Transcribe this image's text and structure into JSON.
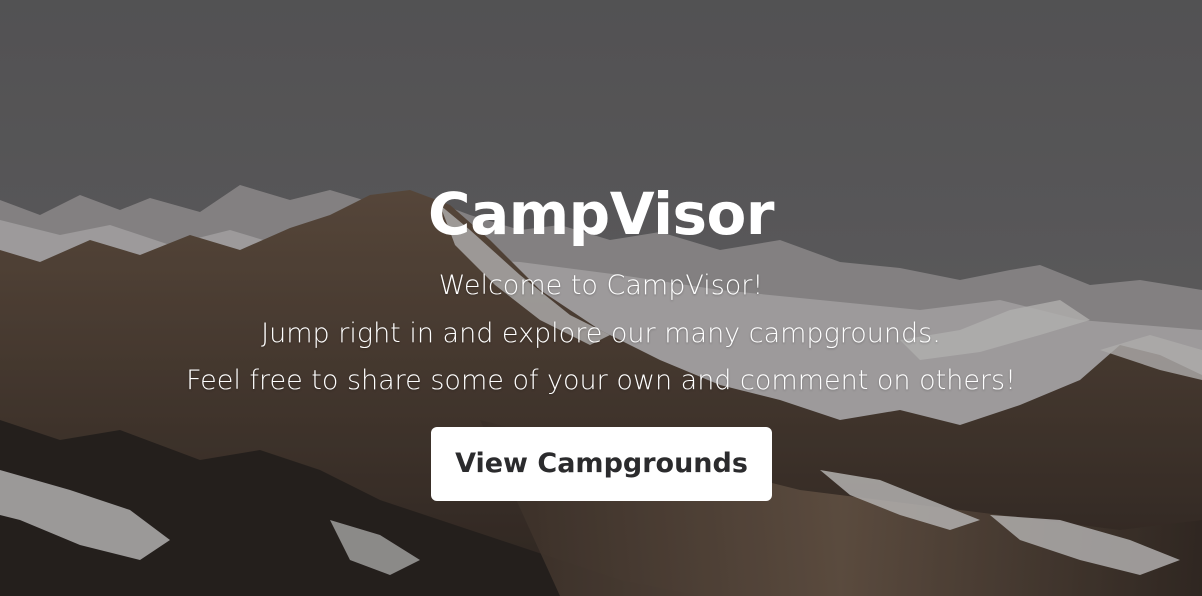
{
  "hero": {
    "title": "CampVisor",
    "lines": [
      "Welcome to CampVisor!",
      "Jump right in and explore our many campgrounds.",
      "Feel free to share some of your own and comment on others!"
    ],
    "button_label": "View Campgrounds"
  },
  "colors": {
    "sky": "#6b6b6d",
    "button_bg": "#ffffff",
    "button_text": "#2b2b2d",
    "text": "#ffffff"
  }
}
